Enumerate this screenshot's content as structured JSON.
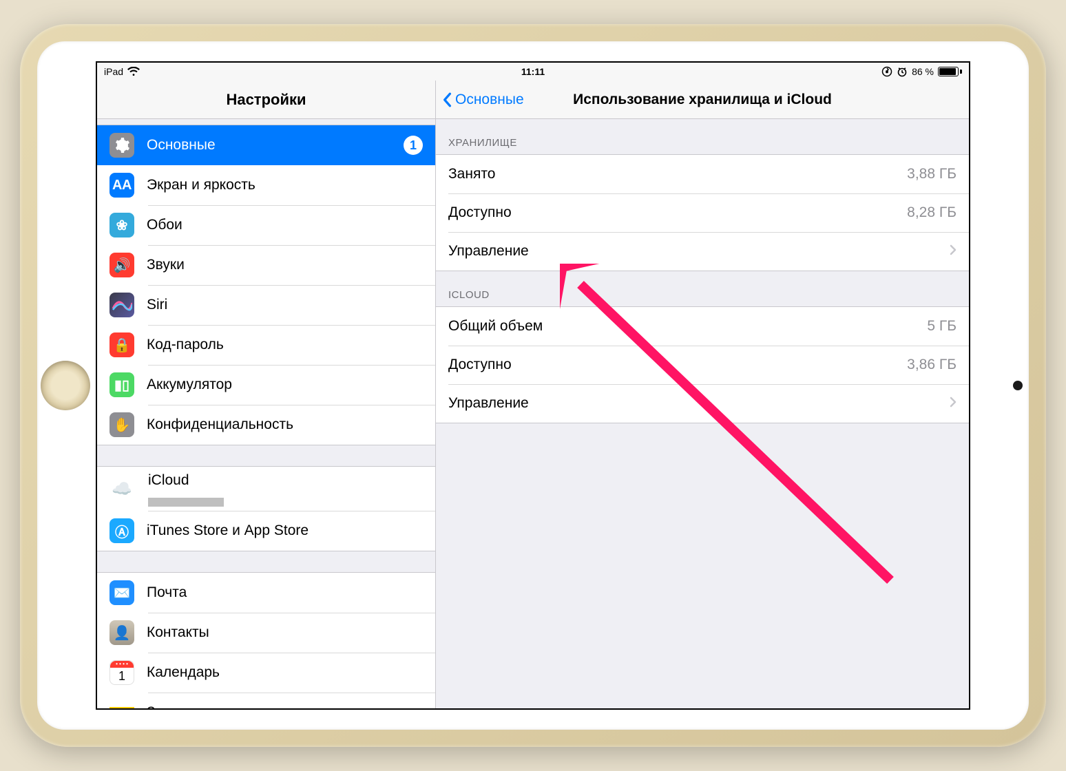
{
  "status": {
    "device": "iPad",
    "time": "11:11",
    "battery_pct": "86 %"
  },
  "sidebar": {
    "title": "Настройки",
    "groups": [
      [
        {
          "label": "Основные",
          "icon": "ic-general",
          "name": "sidebar-item-general",
          "selected": true,
          "badge": "1"
        },
        {
          "label": "Экран и яркость",
          "icon": "ic-display",
          "name": "sidebar-item-display"
        },
        {
          "label": "Обои",
          "icon": "ic-wall",
          "name": "sidebar-item-wallpaper"
        },
        {
          "label": "Звуки",
          "icon": "ic-sound",
          "name": "sidebar-item-sounds"
        },
        {
          "label": "Siri",
          "icon": "ic-siri",
          "name": "sidebar-item-siri"
        },
        {
          "label": "Код-пароль",
          "icon": "ic-pass",
          "name": "sidebar-item-passcode"
        },
        {
          "label": "Аккумулятор",
          "icon": "ic-batt",
          "name": "sidebar-item-battery"
        },
        {
          "label": "Конфиденциальность",
          "icon": "ic-priv",
          "name": "sidebar-item-privacy"
        }
      ],
      [
        {
          "label": "iCloud",
          "icon": "ic-cloud",
          "name": "sidebar-item-icloud",
          "sub_redacted": true
        },
        {
          "label": "iTunes Store и App Store",
          "icon": "ic-store",
          "name": "sidebar-item-itunes"
        }
      ],
      [
        {
          "label": "Почта",
          "icon": "ic-mail",
          "name": "sidebar-item-mail"
        },
        {
          "label": "Контакты",
          "icon": "ic-contacts",
          "name": "sidebar-item-contacts"
        },
        {
          "label": "Календарь",
          "icon": "ic-cal",
          "name": "sidebar-item-calendar"
        },
        {
          "label": "Заметки",
          "icon": "ic-notes",
          "name": "sidebar-item-notes"
        }
      ]
    ]
  },
  "detail": {
    "back_label": "Основные",
    "title": "Использование хранилища и iCloud",
    "sections": [
      {
        "header": "ХРАНИЛИЩЕ",
        "rows": [
          {
            "label": "Занято",
            "value": "3,88 ГБ",
            "name": "row-storage-used"
          },
          {
            "label": "Доступно",
            "value": "8,28 ГБ",
            "name": "row-storage-avail"
          },
          {
            "label": "Управление",
            "chevron": true,
            "name": "row-storage-manage"
          }
        ]
      },
      {
        "header": "ICLOUD",
        "rows": [
          {
            "label": "Общий объем",
            "value": "5 ГБ",
            "name": "row-icloud-total"
          },
          {
            "label": "Доступно",
            "value": "3,86 ГБ",
            "name": "row-icloud-avail"
          },
          {
            "label": "Управление",
            "chevron": true,
            "name": "row-icloud-manage"
          }
        ]
      }
    ]
  },
  "icons": {
    "ic-display": "AA",
    "ic-wall": "❀",
    "ic-sound": "🔊",
    "ic-pass": "🔒",
    "ic-batt": "▮▯",
    "ic-priv": "✋",
    "ic-cloud": "☁️",
    "ic-store": "Ⓐ",
    "ic-mail": "✉️",
    "ic-contacts": "👤"
  },
  "colors": {
    "accent": "#007aff",
    "annotation": "#ff1464"
  }
}
